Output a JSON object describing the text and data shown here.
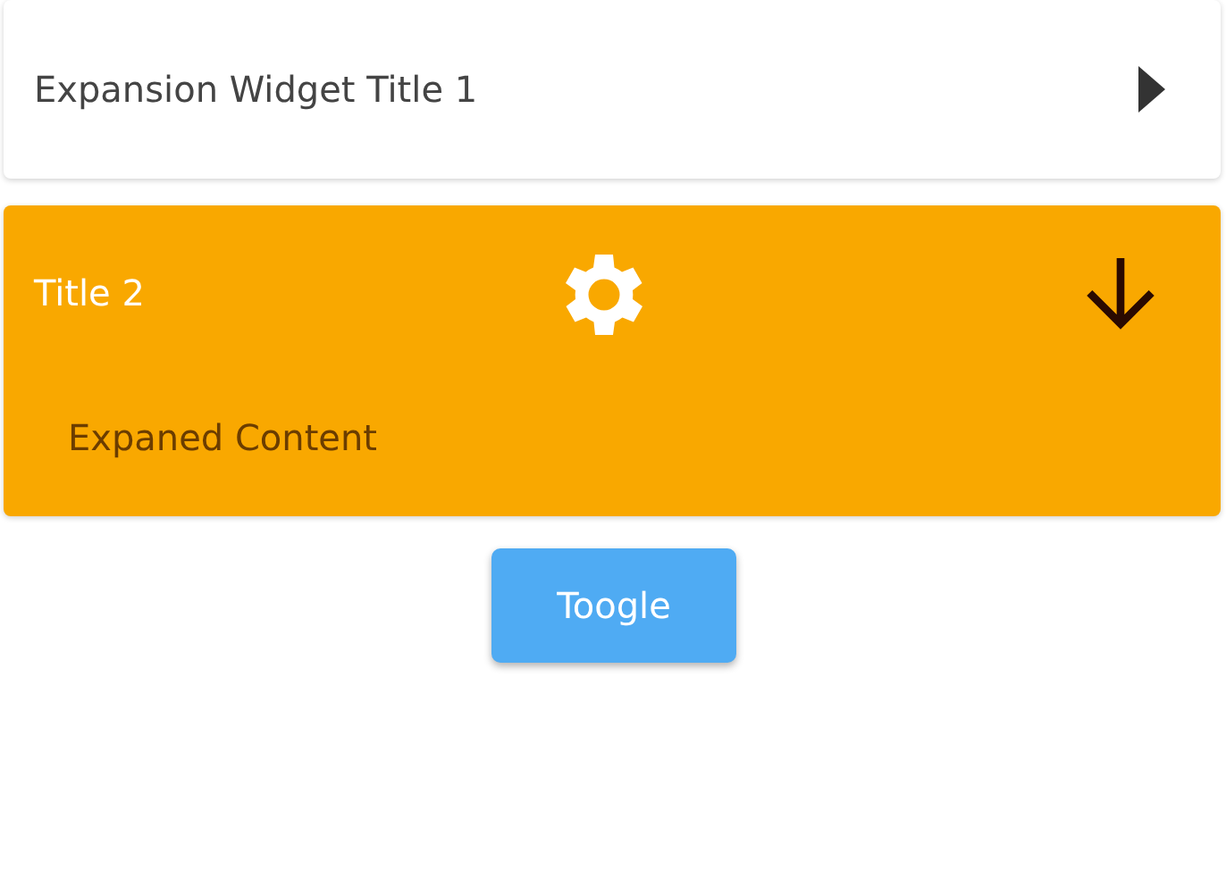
{
  "panels": [
    {
      "kind": "default",
      "title": "Expansion Widget Title 1",
      "expanded": false
    },
    {
      "kind": "custom",
      "title": "Title 2",
      "expanded": true,
      "content": "Expaned Content"
    }
  ],
  "button": {
    "label": "Toogle"
  }
}
